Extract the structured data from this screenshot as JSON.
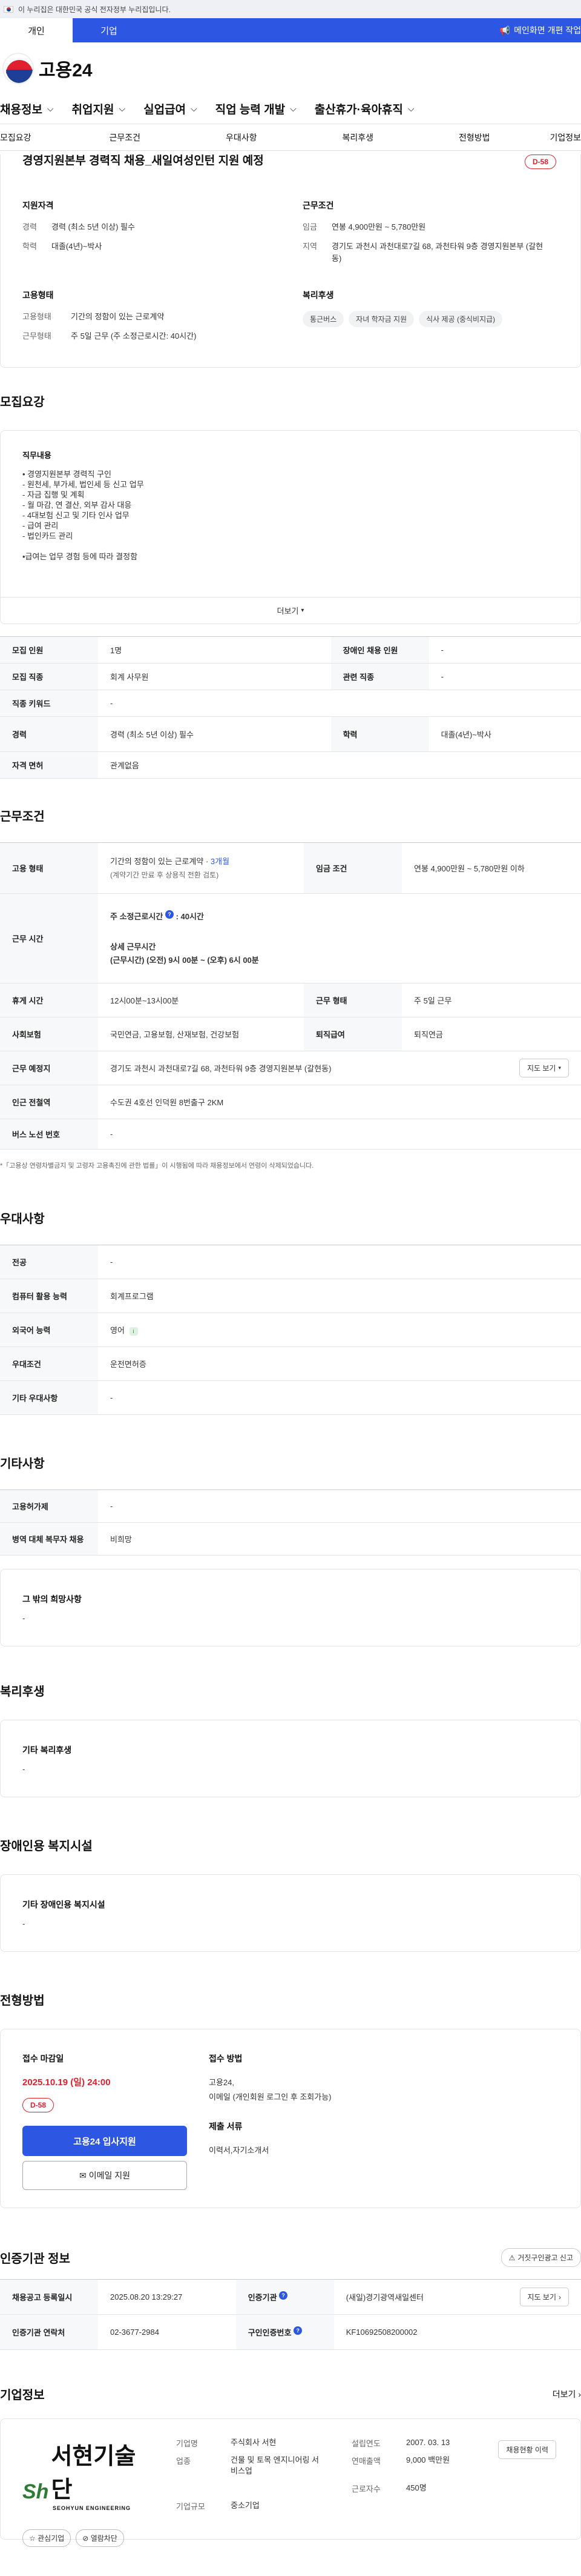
{
  "gov_bar": {
    "text": "이 누리집은 대한민국 공식 전자정부 누리집입니다."
  },
  "top_tabs": [
    "개인",
    "기업"
  ],
  "top_notice": "메인화면 개편 작업",
  "logo": {
    "text": "고용24"
  },
  "gnb": [
    "채용정보",
    "취업지원",
    "실업급여",
    "직업 능력 개발",
    "출산휴가·육아휴직"
  ],
  "subtabs": [
    "모집요강",
    "근무조건",
    "우대사항",
    "복리후생",
    "전형방법",
    "기업정보"
  ],
  "hero": {
    "title": "경영지원본부 경력직 채용_새일여성인턴 지원 예정",
    "dday": "D-58",
    "qual_title": "지원자격",
    "qual": [
      {
        "k": "경력",
        "v": "경력 (최소 5년 이상) 필수"
      },
      {
        "k": "학력",
        "v": "대졸(4년)~박사"
      }
    ],
    "cond_title": "근무조건",
    "cond": [
      {
        "k": "임금",
        "v": "연봉 4,900만원 ~ 5,780만원"
      },
      {
        "k": "지역",
        "v": "경기도 과천시 과천대로7길 68, 과천타워 9층 경영지원본부 (갈현동)"
      }
    ],
    "emp_title": "고용형태",
    "emp": [
      {
        "k": "고용형태",
        "v": "기간의 정함이 있는 근로계약"
      },
      {
        "k": "근무형태",
        "v": "주 5일 근무 (주 소정근로시간: 40시간)"
      }
    ],
    "welfare_title": "복리후생",
    "welfare_chips": [
      "통근버스",
      "자녀 학자금 지원",
      "식사 제공 (중식비지급)"
    ]
  },
  "recruit": {
    "title": "모집요강",
    "duty_title": "직무내용",
    "duty_lines": [
      "• 경영지원본부 경력직 구인",
      "- 원천세, 부가세, 법인세 등 신고 업무",
      "- 자금 집행 및 계획",
      "- 월 마감, 연 결산, 외부 감사 대응",
      "- 4대보험 신고 및 기타 인사 업무",
      "- 급여 관리",
      "- 법인카드 관리",
      "",
      "•급여는 업무 경험 등에 따라 결정함"
    ],
    "more": "더보기",
    "table": [
      [
        {
          "th": "모집 인원",
          "td": "1명"
        },
        {
          "th": "장애인 채용 인원",
          "td": "-"
        }
      ],
      [
        {
          "th": "모집 직종",
          "td": "회계 사무원"
        },
        {
          "th": "관련 직종",
          "td": "-"
        }
      ],
      [
        {
          "th": "직종 키워드",
          "td": "-"
        }
      ],
      [
        {
          "th": "경력",
          "td": "경력 (최소 5년 이상) 필수"
        },
        {
          "th": "학력",
          "td": "대졸(4년)~박사"
        }
      ],
      [
        {
          "th": "자격 면허",
          "td": "관계없음"
        }
      ]
    ]
  },
  "work": {
    "title": "근무조건",
    "emp_th": "고용 형태",
    "emp_td1": "기간의 정함이 있는 근로계약 · ",
    "emp_td1_em": "3개월",
    "emp_td2": "(계약기간 만료 후 상용직 전환 검토)",
    "wage_th": "임금 조건",
    "wage_td": "연봉 4,900만원 ~ 5,780만원 이하",
    "hours_th": "근무 시간",
    "hours_label": "주 소정근로시간",
    "hours_value": ": 40시간",
    "hours_detail_label": "상세 근무시간",
    "hours_detail": "(근무시간) (오전) 9시 00분 ~ (오후) 6시 00분",
    "break_th": "휴게 시간",
    "break_td": "12시00분~13시00분",
    "form_th": "근무 형태",
    "form_td": "주 5일 근무",
    "ins_th": "사회보험",
    "ins_td": "국민연금, 고용보험, 산재보험, 건강보험",
    "ret_th": "퇴직급여",
    "ret_td": "퇴직연금",
    "place_th": "근무 예정지",
    "place_td": "경기도 과천시 과천대로7길 68, 과천타워 9층 경영지원본부 (갈현동)",
    "map_btn": "지도 보기",
    "subway_th": "인근 전철역",
    "subway_td": "수도권 4호선 인덕원 8번출구 2KM",
    "bus_th": "버스 노선 번호",
    "bus_td": "-",
    "note": "*「고용상 연령차별금지 및 고령자 고용촉진에 관한 법률」이 시행됨에 따라 채용정보에서 연령이 삭제되었습니다."
  },
  "pref": {
    "title": "우대사항",
    "rows": [
      {
        "th": "전공",
        "td": "-"
      },
      {
        "th": "컴퓨터 활용 능력",
        "td": "회계프로그램"
      },
      {
        "th": "외국어 능력",
        "td": "영어"
      },
      {
        "th": "우대조건",
        "td": "운전면허증"
      },
      {
        "th": "기타 우대사항",
        "td": "-"
      }
    ]
  },
  "etc": {
    "title": "기타사항",
    "rows": [
      {
        "th": "고용허가제",
        "td": "-"
      },
      {
        "th": "병역 대체 복무자 채용",
        "td": "비희망"
      }
    ],
    "box_title": "그 밖의 희망사항",
    "box_value": "-"
  },
  "welfare": {
    "title": "복리후생",
    "box_title": "기타 복리후생",
    "box_value": "-"
  },
  "disab": {
    "title": "장애인용 복지시설",
    "box_title": "기타 장애인용 복지시설",
    "box_value": "-"
  },
  "apply": {
    "title": "전형방법",
    "deadline_label": "접수 마감일",
    "deadline": "2025.10.19 (일) 24:00",
    "dday": "D-58",
    "btn_apply": "고용24 입사지원",
    "btn_email": "이메일 지원",
    "method_label": "접수 방법",
    "method": [
      "고용24,",
      "이메일 (개인회원 로그인 후 조회가능)"
    ],
    "docs_label": "제출 서류",
    "docs": "이력서,자기소개서"
  },
  "cert": {
    "title": "인증기관 정보",
    "report_btn": "거짓구인광고 신고",
    "reg_th": "채용공고 등록일시",
    "reg_td": "2025.08.20 13:29:27",
    "org_th": "인증기관",
    "org_td": "(새일)경기광역새일센터",
    "map_btn": "지도 보기",
    "tel_th": "인증기관 연락처",
    "tel_td": "02-3677-2984",
    "num_th": "구인인증번호",
    "num_td": "KF10692508200002"
  },
  "company": {
    "title": "기업정보",
    "more": "더보기",
    "logo_mark": "Sh",
    "logo_name": "서현기술단",
    "logo_en": "SEOHYUN ENGINEERING",
    "btn_fav": "관심기업",
    "btn_block": "열람차단",
    "info": [
      {
        "k": "기업명",
        "v": "주식회사 서현",
        "k2": "설립연도",
        "v2": "2007. 03. 13"
      },
      {
        "k": "업종",
        "v": "건물 및 토목 엔지니어링 서비스업",
        "k2": "연매출액",
        "v2": "9,000 백만원"
      },
      {
        "k": "",
        "v": "",
        "k2": "근로자수",
        "v2": "450명"
      },
      {
        "k": "기업규모",
        "v": "중소기업",
        "k2": "",
        "v2": ""
      }
    ],
    "status_btn": "채용현황 이력"
  }
}
